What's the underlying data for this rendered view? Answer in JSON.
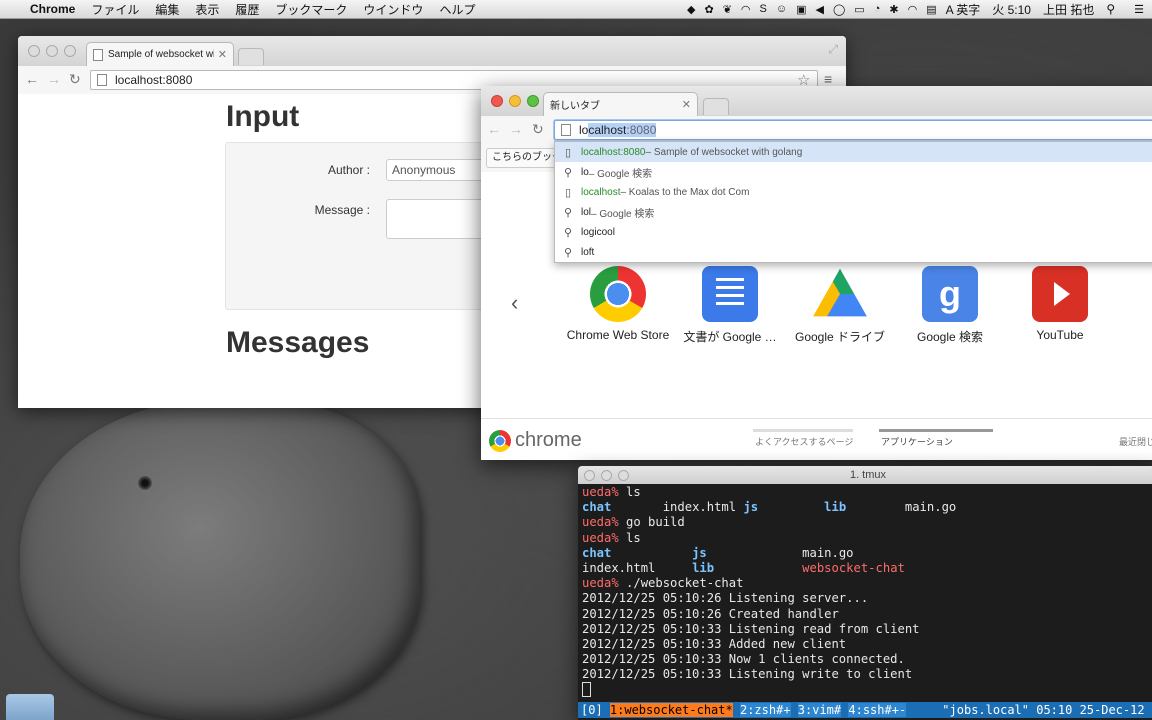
{
  "menubar": {
    "app_name": "Chrome",
    "menus": [
      "ファイル",
      "編集",
      "表示",
      "履歴",
      "ブックマーク",
      "ウインドウ",
      "ヘルプ"
    ],
    "input_mode": "A 英字",
    "clock": "火 5:10",
    "user": "上田 拓也",
    "status_icons": [
      "dropbox-icon",
      "sync-icon",
      "evernote-icon",
      "wifi-icon",
      "skype-icon",
      "smile-icon",
      "display-icon",
      "volume-icon",
      "chat-icon",
      "battery-icon",
      "time-machine-icon",
      "bluetooth-icon",
      "airport-icon",
      "camera-icon",
      "keyboard-icon"
    ]
  },
  "window1": {
    "tab_title": "Sample of websocket with",
    "url": "localhost:8080",
    "page": {
      "heading_input": "Input",
      "author_label": "Author :",
      "author_value": "Anonymous",
      "message_label": "Message :",
      "heading_messages": "Messages"
    }
  },
  "window2": {
    "tab_title": "新しいタブ",
    "omnibox_typed": "lo",
    "omnibox_completion": "calhost",
    "omnibox_rest": ":8080",
    "bookmark_item": "こちらのブック",
    "suggestions": [
      {
        "icon": "page",
        "match": "localhost:8080",
        "desc": " – Sample of websocket with golang",
        "selected": true
      },
      {
        "icon": "search",
        "match": "lo",
        "desc": " – Google 検索",
        "selected": false
      },
      {
        "icon": "page",
        "match": "localhost",
        "desc": " – Koalas to the Max dot Com",
        "selected": false
      },
      {
        "icon": "search",
        "match": "lol",
        "desc": " – Google 検索",
        "selected": false
      },
      {
        "icon": "search",
        "match": "logicool",
        "desc": "",
        "selected": false
      },
      {
        "icon": "search",
        "match": "loft",
        "desc": "",
        "selected": false
      }
    ],
    "apps": [
      "Chrome Web Store",
      "文書が Google …",
      "Google ドライブ",
      "Google 検索",
      "YouTube"
    ],
    "footer": {
      "brand": "chrome",
      "link_most_visited": "よくアクセスするページ",
      "link_apps": "アプリケーション",
      "link_recent": "最近閉じ"
    }
  },
  "terminal": {
    "title": "1. tmux",
    "lines": [
      [
        {
          "c": "pr",
          "t": "ueda%"
        },
        {
          "c": "",
          "t": " ls"
        }
      ],
      [
        {
          "c": "dir",
          "t": "chat"
        },
        {
          "c": "",
          "t": "       index.html "
        },
        {
          "c": "dir",
          "t": "js"
        },
        {
          "c": "",
          "t": "         "
        },
        {
          "c": "dir",
          "t": "lib"
        },
        {
          "c": "",
          "t": "        main.go"
        }
      ],
      [
        {
          "c": "pr",
          "t": "ueda%"
        },
        {
          "c": "",
          "t": " go build"
        }
      ],
      [
        {
          "c": "pr",
          "t": "ueda%"
        },
        {
          "c": "",
          "t": " ls"
        }
      ],
      [
        {
          "c": "dir",
          "t": "chat"
        },
        {
          "c": "",
          "t": "           "
        },
        {
          "c": "dir",
          "t": "js"
        },
        {
          "c": "",
          "t": "             main.go"
        }
      ],
      [
        {
          "c": "",
          "t": "index.html     "
        },
        {
          "c": "dir",
          "t": "lib"
        },
        {
          "c": "",
          "t": "            "
        },
        {
          "c": "exe",
          "t": "websocket-chat"
        }
      ],
      [
        {
          "c": "pr",
          "t": "ueda%"
        },
        {
          "c": "",
          "t": " ./websocket-chat"
        }
      ],
      [
        {
          "c": "",
          "t": "2012/12/25 05:10:26 Listening server..."
        }
      ],
      [
        {
          "c": "",
          "t": "2012/12/25 05:10:26 Created handler"
        }
      ],
      [
        {
          "c": "",
          "t": "2012/12/25 05:10:33 Listening read from client"
        }
      ],
      [
        {
          "c": "",
          "t": "2012/12/25 05:10:33 Added new client"
        }
      ],
      [
        {
          "c": "",
          "t": "2012/12/25 05:10:33 Now 1 clients connected."
        }
      ],
      [
        {
          "c": "",
          "t": "2012/12/25 05:10:33 Listening write to client"
        }
      ]
    ],
    "status": {
      "session": "[0] ",
      "current": "1:websocket-chat*",
      "w2": "2:zsh#+",
      "w3": "3:vim#",
      "w4": "4:ssh#+-",
      "right": "     \"jobs.local\" 05:10 25-Dec-12"
    }
  }
}
